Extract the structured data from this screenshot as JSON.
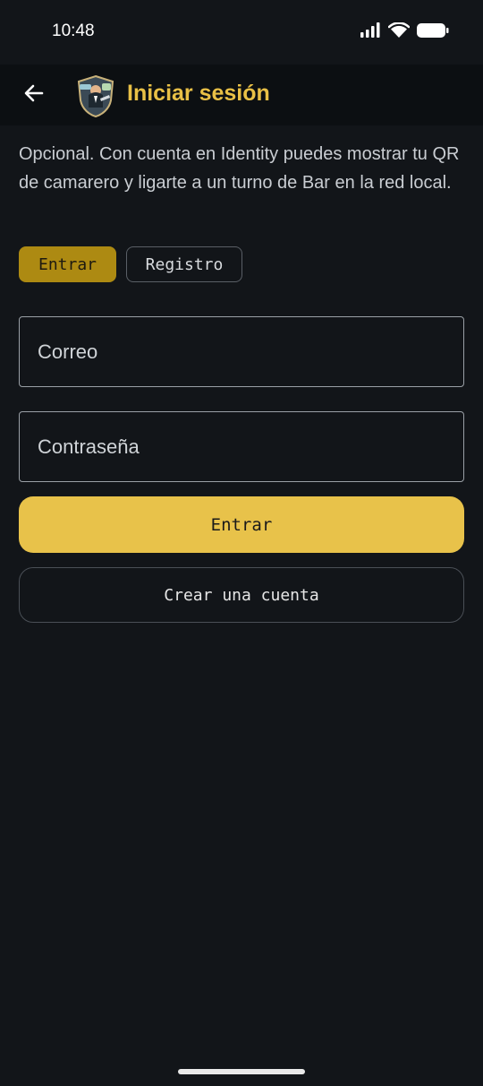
{
  "status_bar": {
    "time": "10:48",
    "icons": [
      "signal-icon",
      "wifi-icon",
      "battery-icon"
    ]
  },
  "app_bar": {
    "back_icon": "arrow-left-icon",
    "logo": "app-logo",
    "title": "Iniciar sesión"
  },
  "intro_text": "Opcional. Con cuenta en Identity puedes mostrar tu QR de camarero y ligarte a un turno de Bar en la red local.",
  "mode_toggle": {
    "login_label": "Entrar",
    "register_label": "Registro",
    "selected": "Entrar"
  },
  "form": {
    "email_placeholder": "Correo",
    "email_value": "",
    "password_placeholder": "Contraseña",
    "password_value": ""
  },
  "actions": {
    "submit_label": "Entrar",
    "create_account_label": "Crear una cuenta"
  },
  "colors": {
    "background": "#121519",
    "accent": "#e8c24a",
    "accent_dark": "#ad8a12",
    "title": "#e9c046"
  }
}
